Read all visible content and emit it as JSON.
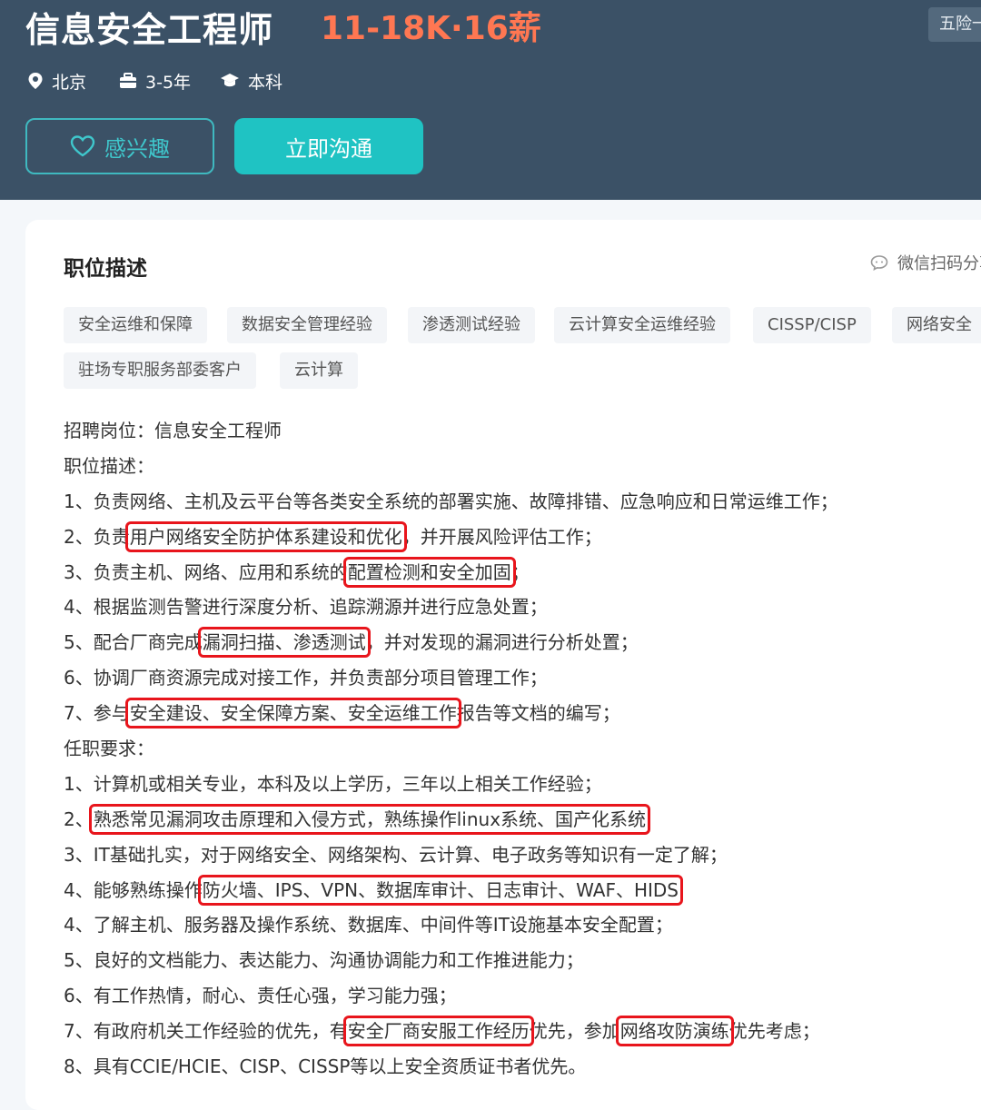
{
  "job": {
    "title": "信息安全工程师",
    "salary": "11-18K·16薪",
    "benefit_tag": "五险一金",
    "city": "北京",
    "experience": "3-5年",
    "education": "本科"
  },
  "actions": {
    "interest_label": "感兴趣",
    "chat_label": "立即沟通"
  },
  "section": {
    "title": "职位描述",
    "share_label": "微信扫码分享"
  },
  "tags": [
    "安全运维和保障",
    "数据安全管理经验",
    "渗透测试经验",
    "云计算安全运维经验",
    "CISSP/CISP",
    "网络安全",
    "驻场专职服务部委客户",
    "云计算"
  ],
  "description": [
    {
      "text": "招聘岗位：信息安全工程师"
    },
    {
      "text": "职位描述："
    },
    {
      "text": "1、负责网络、主机及云平台等各类安全系统的部署实施、故障排错、应急响应和日常运维工作；"
    },
    {
      "pre": "2、负责",
      "hl": "用户网络安全防护体系建设和优化",
      "post": "，并开展风险评估工作；"
    },
    {
      "pre": "3、负责主机、网络、应用和系统的",
      "hl": "配置检测和安全加固",
      "post": "；"
    },
    {
      "text": "4、根据监测告警进行深度分析、追踪溯源并进行应急处置；"
    },
    {
      "pre": "5、配合厂商完成",
      "hl": "漏洞扫描、渗透测试",
      "post": "，并对发现的漏洞进行分析处置；"
    },
    {
      "text": "6、协调厂商资源完成对接工作，并负责部分项目管理工作；"
    },
    {
      "pre": "7、参与",
      "hl": "安全建设、安全保障方案、安全运维工作",
      "post": "报告等文档的编写；"
    },
    {
      "text": "任职要求："
    },
    {
      "text": "1、计算机或相关专业，本科及以上学历，三年以上相关工作经验；"
    },
    {
      "pre": "2、",
      "hl": "熟悉常见漏洞攻击原理和入侵方式，熟练操作linux系统、国产化系统",
      "post": ""
    },
    {
      "text": "3、IT基础扎实，对于网络安全、网络架构、云计算、电子政务等知识有一定了解；"
    },
    {
      "pre": "4、能够熟练操作",
      "hl": "防火墙、IPS、VPN、数据库审计、日志审计、WAF、HIDS",
      "post": ""
    },
    {
      "text": "4、了解主机、服务器及操作系统、数据库、中间件等IT设施基本安全配置；"
    },
    {
      "text": "5、良好的文档能力、表达能力、沟通协调能力和工作推进能力；"
    },
    {
      "text": "6、有工作热情，耐心、责任心强，学习能力强；"
    },
    {
      "pre": "7、有政府机关工作经验的优先，有",
      "hl": "安全厂商安服工作经历",
      "mid": "优先，参加",
      "hl2": "网络攻防演练",
      "post": "优先考虑；"
    },
    {
      "text": "8、具有CCIE/HCIE、CISP、CISSP等以上安全资质证书者优先。"
    }
  ],
  "colors": {
    "header_bg": "#3b5166",
    "salary": "#ff7752",
    "accent": "#1fc3c3",
    "highlight_box": "#e8151c"
  }
}
